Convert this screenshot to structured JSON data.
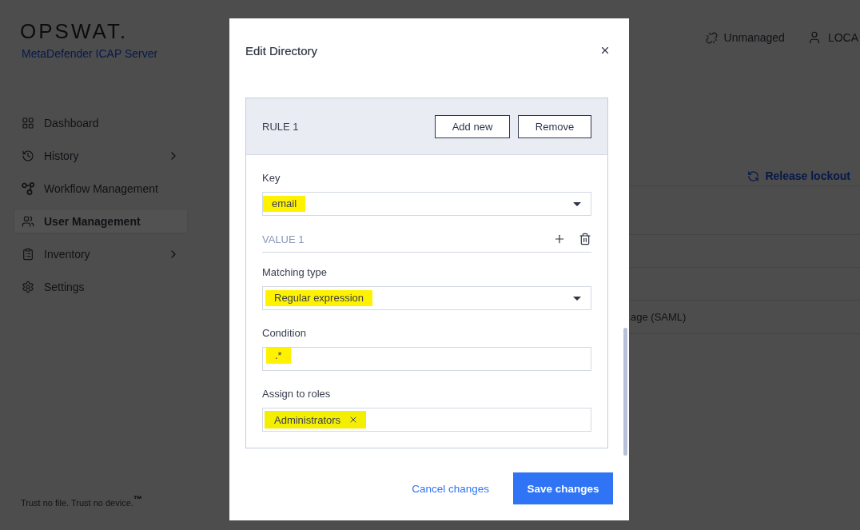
{
  "brand": {
    "logo": "OPSWAT.",
    "product": "MetaDefender ICAP Server"
  },
  "sidebar": {
    "items": [
      {
        "label": "Dashboard",
        "selected": false,
        "expandable": false
      },
      {
        "label": "History",
        "selected": false,
        "expandable": true
      },
      {
        "label": "Workflow Management",
        "selected": false,
        "expandable": false
      },
      {
        "label": "User Management",
        "selected": true,
        "expandable": false
      },
      {
        "label": "Inventory",
        "selected": false,
        "expandable": true
      },
      {
        "label": "Settings",
        "selected": false,
        "expandable": false
      }
    ],
    "footer": "Trust no file. Trust no device.$^{™}$"
  },
  "topbar": {
    "items": [
      {
        "kind": "status",
        "label": "Unmanaged"
      },
      {
        "kind": "user",
        "label": "LOCA"
      }
    ]
  },
  "page": {
    "action": "Release lockout",
    "table": {
      "rows": [
        {
          "column_1": "age (SAML)"
        }
      ]
    }
  },
  "dialog": {
    "title": "Edit Directory",
    "rule": {
      "title": "RULE 1",
      "buttons": [
        "Add new",
        "Remove"
      ],
      "fields": [
        {
          "kind": "select",
          "label": "Key",
          "value": "email",
          "highlighted": true
        },
        {
          "kind": "section",
          "label": "VALUE 1"
        },
        {
          "kind": "select",
          "label": "Matching type",
          "value": "Regular expression",
          "highlighted": true
        },
        {
          "kind": "text",
          "label": "Condition",
          "value": ".*",
          "highlighted": true
        },
        {
          "kind": "tags",
          "label": "Assign to roles",
          "tags": [
            {
              "label": "Administrators",
              "highlighted": true
            }
          ]
        }
      ]
    },
    "buttons": [
      {
        "kind": "link",
        "label": "Cancel changes"
      },
      {
        "kind": "primary",
        "label": "Save changes"
      }
    ]
  }
}
